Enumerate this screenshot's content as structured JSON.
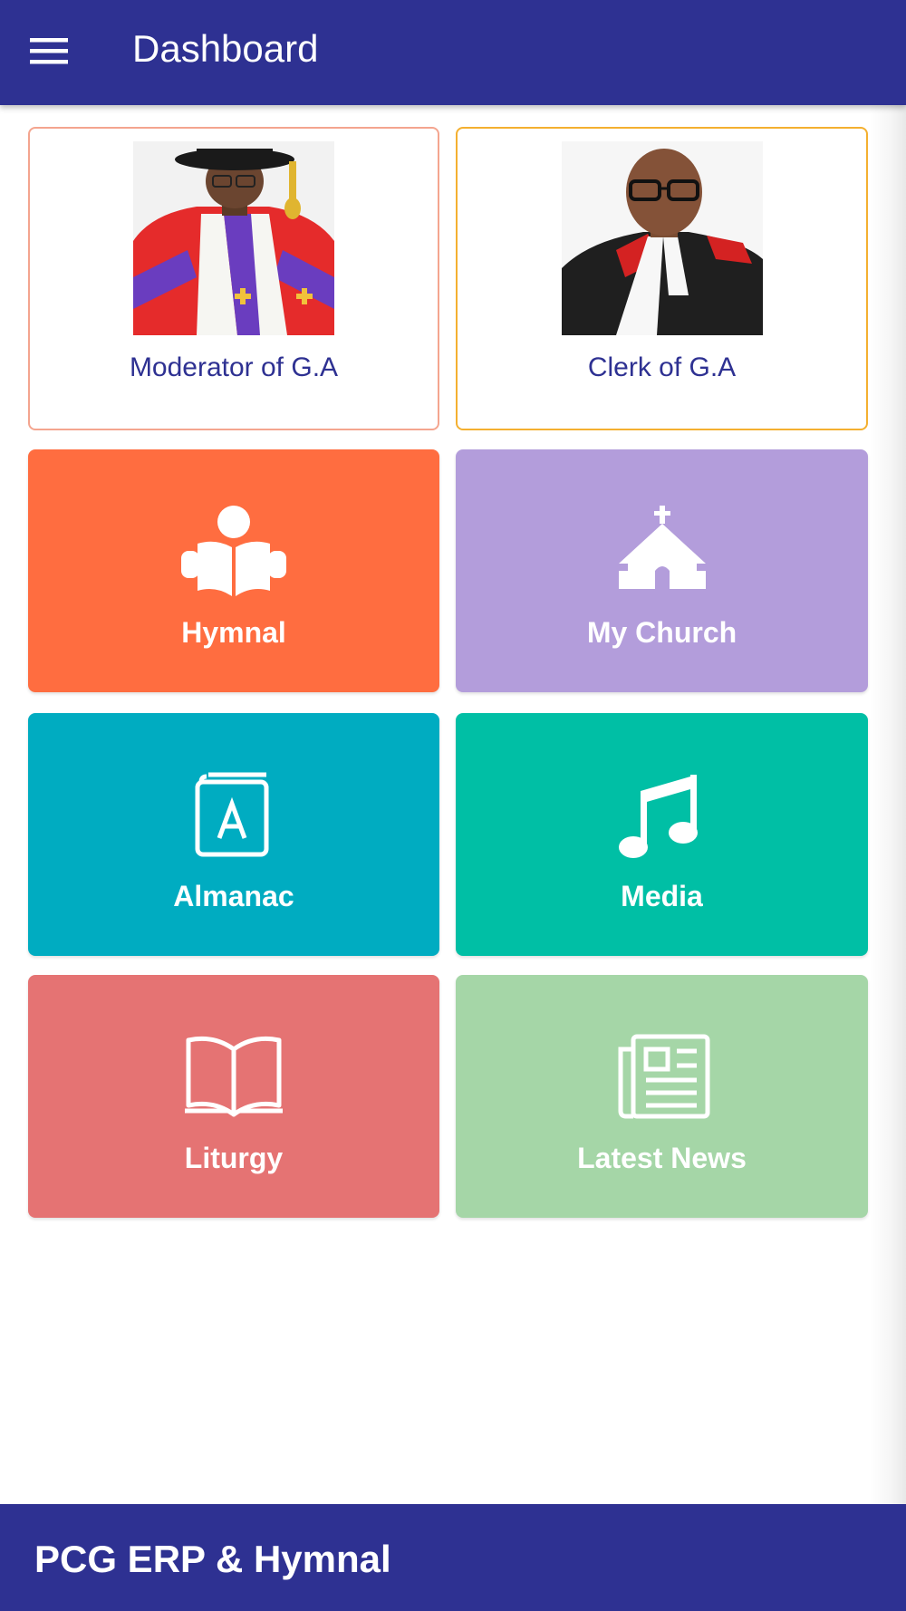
{
  "app_bar": {
    "title": "Dashboard",
    "menu_icon": "hamburger-menu-icon"
  },
  "leaders": [
    {
      "name": "Moderator of G.A",
      "image": "moderator-portrait"
    },
    {
      "name": "Clerk of G.A",
      "image": "clerk-portrait"
    }
  ],
  "tiles": [
    {
      "label": "Hymnal",
      "icon": "reading-person-icon",
      "color": "#ff6d40"
    },
    {
      "label": "My Church",
      "icon": "church-icon",
      "color": "#b39ddb"
    },
    {
      "label": "Almanac",
      "icon": "almanac-book-icon",
      "color": "#00acc1"
    },
    {
      "label": "Media",
      "icon": "music-note-icon",
      "color": "#00bfa5"
    },
    {
      "label": "Liturgy",
      "icon": "open-book-icon",
      "color": "#e57373"
    },
    {
      "label": "Latest News",
      "icon": "newspaper-icon",
      "color": "#a5d6a7"
    }
  ],
  "footer": {
    "title": "PCG ERP & Hymnal"
  },
  "colors": {
    "primary": "#2e3192",
    "background": "#ffffff"
  }
}
